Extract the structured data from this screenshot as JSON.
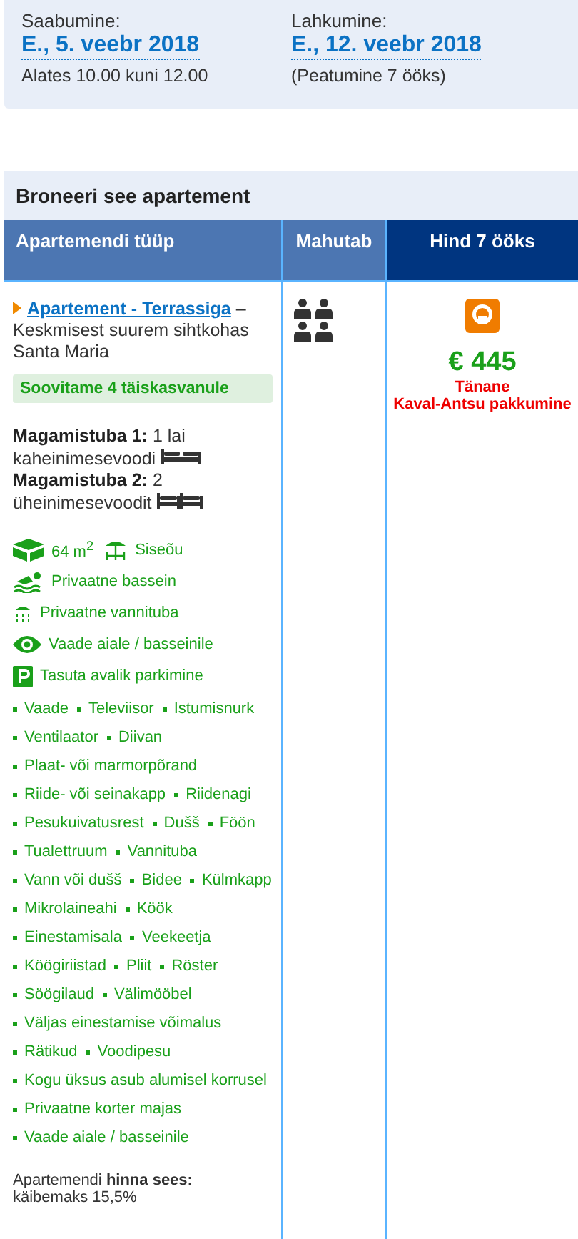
{
  "stay": [
    {
      "label": "Saabumine:",
      "date": "E., 5. veebr 2018",
      "note": "Alates 10.00 kuni 12.00"
    },
    {
      "label": "Lahkumine:",
      "date": "E., 12. veebr 2018",
      "note": "(Peatumine 7 ööks)"
    }
  ],
  "section_title": "Broneeri see apartement",
  "table": {
    "columns": [
      "Apartemendi tüüp",
      "Mahutab",
      "Hind 7 ööks"
    ],
    "row": {
      "name": "Apartement - Terrassiga",
      "description": "– Keskmisest suurem sihtkohas Santa Maria",
      "recommendation": "Soovitame 4 täiskasvanule",
      "bedrooms": [
        {
          "label": "Magamistuba 1:",
          "text": "1 lai kaheinimesevoodi",
          "beds": [
            {
              "kind": "double"
            }
          ]
        },
        {
          "label": "Magamistuba 2:",
          "text": "2 üheinimesevoodit",
          "beds": [
            {
              "kind": "single"
            },
            {
              "kind": "single"
            }
          ]
        }
      ],
      "features": [
        [
          {
            "kind": "area",
            "text": "64 m$^{2}$"
          },
          {
            "kind": "patio",
            "text": "Siseõu"
          }
        ],
        [
          {
            "kind": "pool",
            "text": "Privaatne bassein"
          }
        ],
        [
          {
            "kind": "shower",
            "text": "Privaatne vannituba"
          }
        ],
        [
          {
            "kind": "eye",
            "text": "Vaade aiale / basseinile"
          }
        ],
        [
          {
            "kind": "parking",
            "text": "Tasuta avalik parkimine"
          }
        ]
      ],
      "amenities": [
        [
          "Vaade",
          "Televiisor",
          "Istumisnurk"
        ],
        [
          "Ventilaator",
          "Diivan"
        ],
        [
          "Plaat- või marmorpõrand"
        ],
        [
          "Riide- või seinakapp",
          "Riidenagi"
        ],
        [
          "Pesukuivatusrest",
          "Dušš",
          "Föön"
        ],
        [
          "Tualettruum",
          "Vannituba"
        ],
        [
          "Vann või dušš",
          "Bidee",
          "Külmkapp"
        ],
        [
          "Mikrolaineahi",
          "Köök"
        ],
        [
          "Einestamisala",
          "Veekeetja"
        ],
        [
          "Köögiriistad",
          "Pliit",
          "Röster"
        ],
        [
          "Söögilaud",
          "Välimööbel"
        ],
        [
          "Väljas einestamise võimalus"
        ],
        [
          "Rätikud",
          "Voodipesu"
        ],
        [
          "Kogu üksus asub alumisel korrusel"
        ],
        [
          "Privaatne korter majas"
        ],
        [
          "Vaade aiale / basseinile"
        ]
      ],
      "included": [
        "Apartemendi **hinna sees:**",
        "käibemaks 15,5%"
      ],
      "price": "€ 445",
      "deal": [
        "Tänane",
        "Kaval-Antsu pakkumine"
      ]
    }
  }
}
